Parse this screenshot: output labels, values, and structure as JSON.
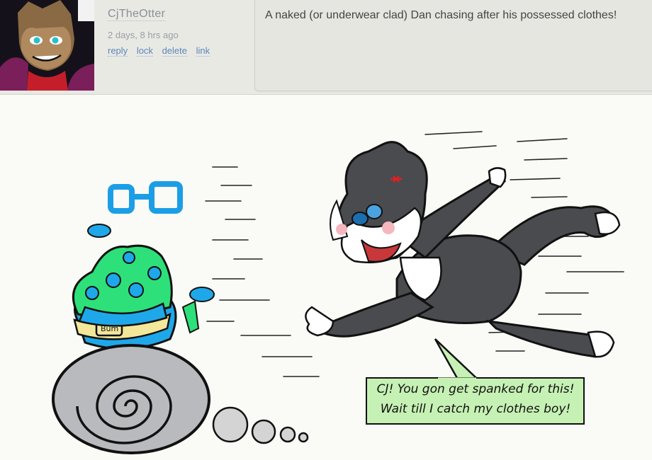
{
  "comment": {
    "username": "CjTheOtter",
    "timestamp": "2 days, 8 hrs ago",
    "actions": [
      "reply",
      "lock",
      "delete",
      "link"
    ],
    "message": "A naked (or underwear clad) Dan chasing after his possessed clothes!"
  },
  "artwork": {
    "belt_label": "Bum",
    "speech_lines": [
      "CJ! You gon get spanked for this!",
      "Wait till I catch my clothes boy!"
    ]
  },
  "colors": {
    "link": "#5b87b8",
    "username": "#8a8f96",
    "speech_bubble": "#c6f1b4",
    "hat_green": "#2ee07a",
    "shorts_blue": "#1fa8e9",
    "cat_fur": "#4a4b4f"
  }
}
